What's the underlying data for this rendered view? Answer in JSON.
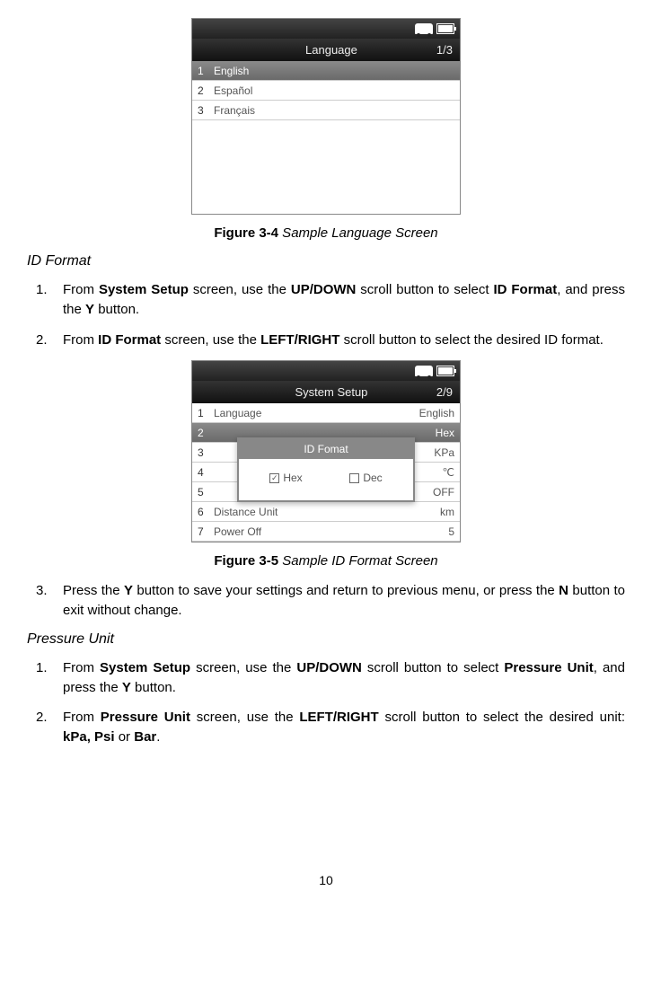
{
  "langScreen": {
    "title": "Language",
    "counter": "1/3",
    "items": [
      {
        "num": "1",
        "label": "English",
        "selected": true
      },
      {
        "num": "2",
        "label": "Español",
        "selected": false
      },
      {
        "num": "3",
        "label": "Français",
        "selected": false
      }
    ]
  },
  "figure1": {
    "label": "Figure 3-4",
    "title": " Sample Language Screen"
  },
  "section1": "ID Format",
  "idFormatSteps": {
    "s1a": "From ",
    "s1b": "System Setup",
    "s1c": " screen, use the ",
    "s1d": "UP/DOWN",
    "s1e": " scroll button to select ",
    "s1f": "ID Format",
    "s1g": ", and press the ",
    "s1h": "Y",
    "s1i": " button.",
    "s2a": "From ",
    "s2b": "ID Format",
    "s2c": " screen, use the ",
    "s2d": "LEFT/RIGHT",
    "s2e": " scroll button to select the desired ID format."
  },
  "setupScreen": {
    "title": "System Setup",
    "counter": "2/9",
    "popupTitle": "ID Fomat",
    "option1": "Hex",
    "option2": "Dec",
    "items": [
      {
        "num": "1",
        "label": "Language",
        "value": "English"
      },
      {
        "num": "2",
        "label": "",
        "value": "Hex",
        "selected": true
      },
      {
        "num": "3",
        "label": "",
        "value": "KPa"
      },
      {
        "num": "4",
        "label": "",
        "value": "℃"
      },
      {
        "num": "5",
        "label": "",
        "value": "OFF"
      },
      {
        "num": "6",
        "label": "Distance Unit",
        "value": "km"
      },
      {
        "num": "7",
        "label": "Power Off",
        "value": "5"
      }
    ]
  },
  "figure2": {
    "label": "Figure 3-5",
    "title": " Sample ID Format Screen"
  },
  "step3": {
    "a": "Press the ",
    "b": "Y",
    "c": " button to save your settings and return to previous menu, or press the ",
    "d": "N",
    "e": " button to exit without change."
  },
  "section2": "Pressure Unit",
  "pressureSteps": {
    "s1a": "From ",
    "s1b": "System Setup",
    "s1c": " screen, use the ",
    "s1d": "UP/DOWN",
    "s1e": " scroll button to select ",
    "s1f": "Pressure Unit",
    "s1g": ", and press the ",
    "s1h": "Y",
    "s1i": " button.",
    "s2a": "From ",
    "s2b": "Pressure Unit",
    "s2c": " screen, use the ",
    "s2d": "LEFT/RIGHT",
    "s2e": " scroll button to select the desired unit: ",
    "s2f": "kPa, Psi",
    "s2g": " or ",
    "s2h": "Bar",
    "s2i": "."
  },
  "pageNumber": "10"
}
